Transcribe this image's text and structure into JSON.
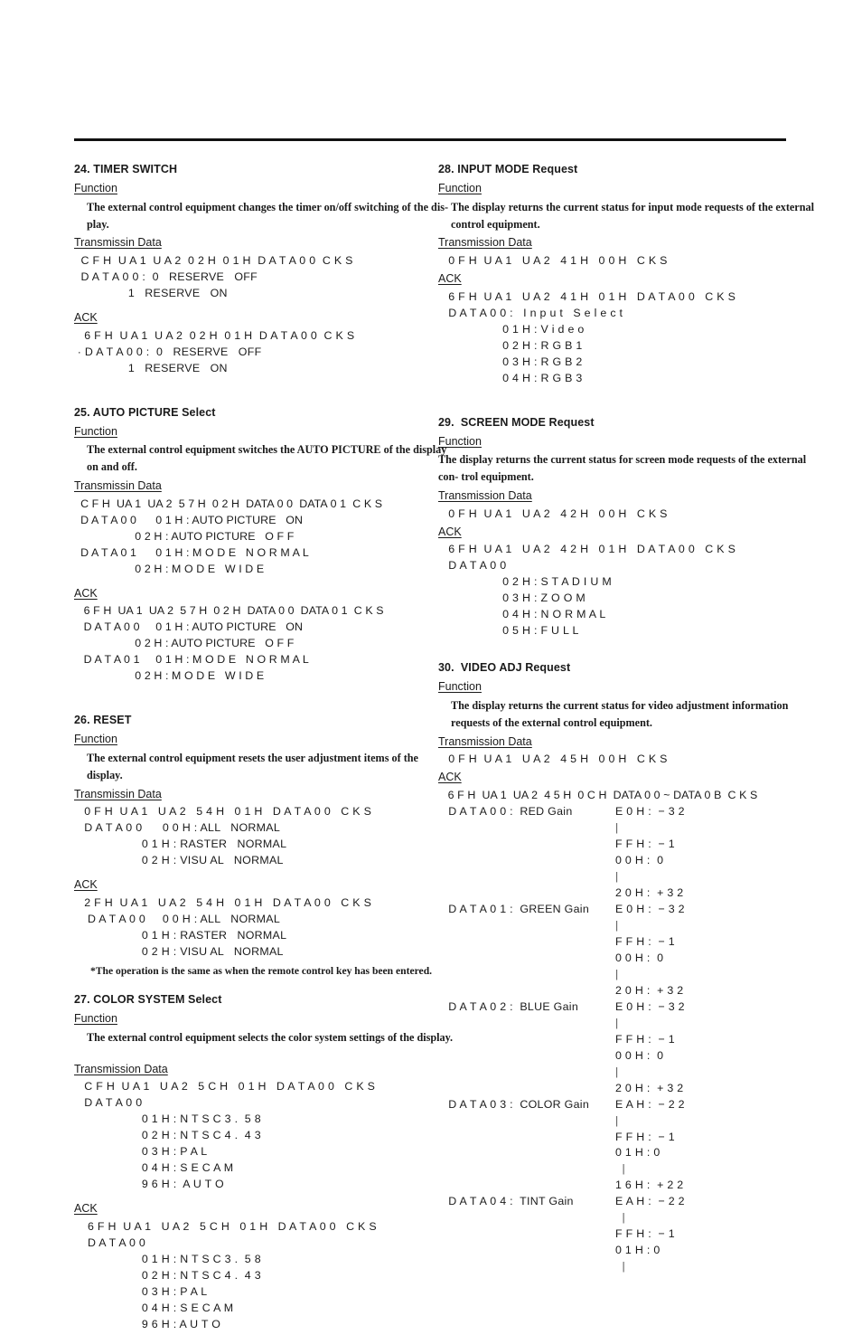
{
  "page": {
    "divider": true
  },
  "left_column": [
    {
      "id": "sec24",
      "title": "24. TIMER SWITCH",
      "function_label": "Function",
      "function_text": "The external control equipment changes the timer on/off switching of the dis-\nplay.",
      "tx_label": "Transmissin Data",
      "tx_lines": [
        "  C F H  U A 1  U A 2  0 2 H  0 1 H  D A T A 0 0  C K S",
        "  D A T A 0 0 :  0   RESERVE   OFF",
        "                1   RESERVE   ON"
      ],
      "ack_label": "ACK",
      "ack_lines": [
        "   6 F H  U A 1  U A 2  0 2 H  0 1 H  D A T A 0 0  C K S",
        " · D A T A 0 0 :  0   RESERVE   OFF",
        "                1   RESERVE   ON"
      ]
    },
    {
      "id": "sec25",
      "title": "25. AUTO PICTURE Select",
      "function_label": "Function",
      "function_text": "The external control equipment switches the AUTO PICTURE of the display on\nand off.",
      "tx_label": "Transmissin Data",
      "tx_lines": [
        "  C F H  UA 1  UA 2  5 7 H  0 2 H  DATA 0 0  DATA 0 1  C K S",
        "  D A T A 0 0      0 1 H : AUTO PICTURE   ON",
        "                   0 2 H : AUTO PICTURE   O F F",
        "  D A T A 0 1      0 1 H : M O D E   N O R M A L",
        "                   0 2 H : M O D E   W I D E"
      ],
      "ack_label": "ACK",
      "ack_lines": [
        "   6 F H  UA 1  UA 2  5 7 H  0 2 H  DATA 0 0  DATA 0 1  C K S",
        "   D A T A 0 0     0 1 H : AUTO PICTURE   ON",
        "                   0 2 H : AUTO PICTURE   O F F",
        "   D A T A 0 1     0 1 H : M O D E   N O R M A L",
        "                   0 2 H : M O D E   W I D E"
      ]
    },
    {
      "id": "sec26",
      "title": "26. RESET",
      "function_label": "Function",
      "function_text": "The external control equipment resets the user adjustment items of the display.",
      "tx_label": "Transmissin Data",
      "tx_lines": [
        "   0 F H  U A 1   U A 2   5 4 H   0 1 H   D A T A 0 0   C K S",
        "   D A T A 0 0      0 0 H : ALL   NORMAL",
        "                    0 1 H : RASTER   NORMAL",
        "                    0 2 H : VISU AL   NORMAL"
      ],
      "ack_label": "ACK",
      "ack_lines": [
        "   2 F H  U A 1   U A 2   5 4 H   0 1 H   D A T A 0 0   C K S",
        "    D A T A 0 0     0 0 H : ALL   NORMAL",
        "                    0 1 H : RASTER   NORMAL",
        "                    0 2 H : VISU AL   NORMAL"
      ],
      "note": "*The operation is the same as when the remote control key has been entered."
    },
    {
      "id": "sec27",
      "title": "27. COLOR SYSTEM Select",
      "function_label": "Function",
      "function_text": "The external control equipment selects the color system settings of the display.",
      "tx_label": "Transmission Data",
      "tx_lines": [
        "   C F H  U A 1   U A 2   5 C H   0 1 H   D A T A 0 0   C K S",
        "   D A T A 0 0",
        "                    0 1 H : N T S C 3 .  5 8",
        "                    0 2 H : N T S C 4 .  4 3",
        "                    0 3 H : P A L",
        "                    0 4 H : S E C A M",
        "                    9 6 H :  A U T O"
      ],
      "ack_label": "ACK",
      "ack_lines": [
        "    6 F H  U A 1   U A 2   5 C H   0 1 H   D A T A 0 0   C K S",
        "    D A T A 0 0",
        "                    0 1 H : N T S C 3 .  5 8",
        "                    0 2 H : N T S C 4 .  4 3",
        "                    0 3 H : P A L",
        "                    0 4 H : S E C A M",
        "                    9 6 H : A U T O"
      ]
    }
  ],
  "right_column": [
    {
      "id": "sec28",
      "title": "28. INPUT MODE Request",
      "function_label": "Function",
      "function_text": "The display returns the current status for input mode requests of the external\ncontrol equipment.",
      "tx_label": "Transmission Data",
      "tx_lines": [
        "   0 F H  U A 1   U A 2   4 1 H   0 0 H   C K S"
      ],
      "ack_label": "ACK",
      "ack_lines": [
        "   6 F H  U A 1   U A 2   4 1 H   0 1 H   D A T A 0 0   C K S",
        "   D A T A 0 0 :   I n p u t   S e l e c t",
        "                   0 1 H : V i d e o",
        "                   0 2 H : R G B 1",
        "                   0 3 H : R G B 2",
        "                   0 4 H : R G B 3"
      ]
    },
    {
      "id": "sec29",
      "title": "29.  SCREEN MODE Request",
      "function_label": "Function",
      "function_text": "The display returns the current status for screen mode requests of the external con-\ntrol equipment.",
      "function_indent": false,
      "tx_label": "Transmission Data",
      "tx_lines": [
        "   0 F H  U A 1   U A 2   4 2 H   0 0 H   C K S"
      ],
      "ack_label": "ACK",
      "ack_lines": [
        "   6 F H  U A 1   U A 2   4 2 H   0 1 H   D A T A 0 0   C K S",
        "   D A T A 0 0",
        "                   0 2 H : S T A D I U M",
        "                   0 3 H : Z O O M",
        "                   0 4 H : N O R M A L",
        "                   0 5 H : F U L L"
      ]
    },
    {
      "id": "sec30",
      "title": "30.  VIDEO ADJ Request",
      "function_label": "Function",
      "function_text": "The display returns the current status for video adjustment information requests\nof the external control equipment.",
      "tx_label": "Transmission Data",
      "tx_lines": [
        "   0 F H  U A 1   U A 2   4 5 H   0 0 H   C K S"
      ],
      "ack_label": "ACK",
      "ack_header": "   6 F H  UA 1  UA 2  4 5 H  0 C H  DATA 0 0 ~ DATA 0 B  C K S",
      "gain_rows": [
        {
          "key": "   D A T A 0 0 :  RED Gain",
          "values": [
            "E 0 H :  − 3 2",
            "|",
            "F F H :  − 1",
            "0 0 H :  0",
            "|",
            "2 0 H :  + 3 2"
          ]
        },
        {
          "key": "   D A T A 0 1 :  GREEN Gain",
          "values": [
            "E 0 H :  − 3 2",
            "|",
            "F F H :  − 1",
            "0 0 H :  0",
            "|",
            "2 0 H :  + 3 2"
          ]
        },
        {
          "key": "   D A T A 0 2 :  BLUE Gain",
          "values": [
            "E 0 H :  − 3 2",
            "|",
            "F F H :  − 1",
            "0 0 H :  0",
            "|",
            "2 0 H :  + 3 2"
          ]
        },
        {
          "key": "   D A T A 0 3 :  COLOR Gain",
          "values": [
            "E A H :  − 2 2",
            "|",
            "F F H :  − 1",
            "0 1 H : 0",
            "  |",
            "1 6 H :  + 2 2"
          ]
        },
        {
          "key": "   D A T A 0 4 :  TINT Gain",
          "values": [
            "E A H :  − 2 2",
            "  |",
            "F F H :  − 1",
            "0 1 H : 0",
            "  |"
          ]
        }
      ]
    }
  ]
}
